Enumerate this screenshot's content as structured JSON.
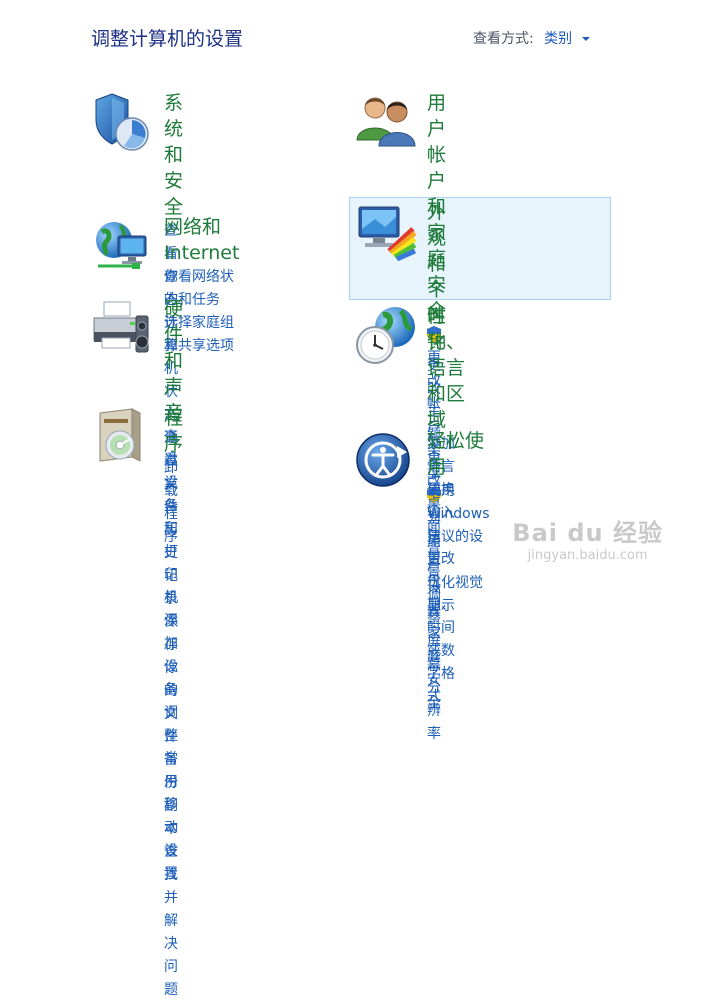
{
  "header": {
    "title": "调整计算机的设置",
    "view_by_label": "查看方式:",
    "view_by_value": "类别"
  },
  "left": [
    {
      "title": "系统和安全",
      "icon": "shield-icon",
      "links": [
        "查看你的计算机状态",
        "通过文件历史记录保存你",
        "的文件备份副本",
        "查找并解决问题"
      ]
    },
    {
      "title": "网络和 Internet",
      "icon": "network-icon",
      "links": [
        "查看网络状态和任务",
        "选择家庭组和共享选项"
      ]
    },
    {
      "title": "硬件和声音",
      "icon": "printer-icon",
      "links": [
        "查看设备和打印机",
        "添加设备",
        "调整常用移动设置"
      ]
    },
    {
      "title": "程序",
      "icon": "programs-icon",
      "links": [
        "卸载程序"
      ]
    }
  ],
  "right": [
    {
      "title_line1": "用户帐户和家庭安",
      "title_line2": "全",
      "icon": "users-icon",
      "links": [
        "更改帐户类型",
        "为用户设置家庭安全"
      ]
    },
    {
      "title": "外观和个性化",
      "icon": "appearance-icon",
      "links": [
        "更改主题",
        "更改桌面背景",
        "调整屏幕分辨率"
      ]
    },
    {
      "title": "时钟、语言和区域",
      "icon": "clock-globe-icon",
      "links": [
        "添加语言",
        "更换输入法",
        "更改日期、时间或数字格",
        "式"
      ]
    },
    {
      "title": "轻松使用",
      "icon": "ease-of-access-icon",
      "links": [
        "使用 Windows 建议的设",
        "置",
        "优化视觉显示"
      ]
    }
  ],
  "watermark": {
    "logo": "Bai du 经验",
    "url": "jingyan.baidu.com"
  },
  "colors": {
    "category_title": "#1e7b3a",
    "link": "#1e5fb8",
    "page_title": "#1e3287",
    "hover_bg": "#e8f4fb",
    "hover_border": "#a7d3ee"
  }
}
